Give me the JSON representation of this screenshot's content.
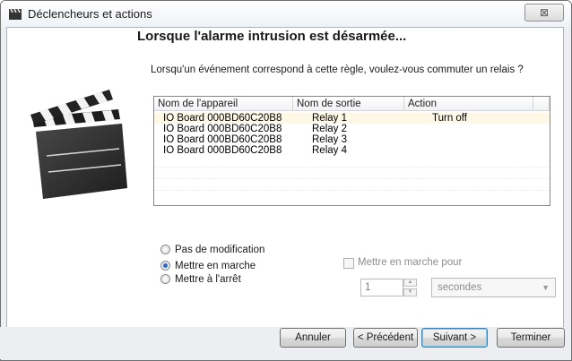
{
  "window": {
    "title": "Déclencheurs et actions",
    "close_symbol": "⊠",
    "title_icon": "clapperboard-icon"
  },
  "heading": "Lorsque l'alarme intrusion est désarmée...",
  "question": "Lorsqu'un événement correspond à cette règle, voulez-vous commuter un relais ?",
  "illustration": "clapperboard-icon",
  "list": {
    "columns": [
      "Nom de l'appareil",
      "Nom de sortie",
      "Action"
    ],
    "rows": [
      {
        "device": "IO Board 000BD60C20B8",
        "output": "Relay 1",
        "action": "Turn off"
      },
      {
        "device": "IO Board 000BD60C20B8",
        "output": "Relay 2",
        "action": ""
      },
      {
        "device": "IO Board 000BD60C20B8",
        "output": "Relay 3",
        "action": ""
      },
      {
        "device": "IO Board 000BD60C20B8",
        "output": "Relay 4",
        "action": ""
      }
    ]
  },
  "options": {
    "no_change": "Pas de modification",
    "turn_on": "Mettre en marche",
    "turn_off": "Mettre à l'arrêt",
    "selected": "turn_on"
  },
  "duration": {
    "checkbox_label": "Mettre en marche pour",
    "checked": false,
    "value": "1",
    "unit": "secondes"
  },
  "buttons": {
    "cancel": "Annuler",
    "previous": "< Précédent",
    "next": "Suivant >",
    "finish": "Terminer"
  },
  "colors": {
    "selected_row": "#fff8e6",
    "default_button_border": "#3c7fb1"
  }
}
